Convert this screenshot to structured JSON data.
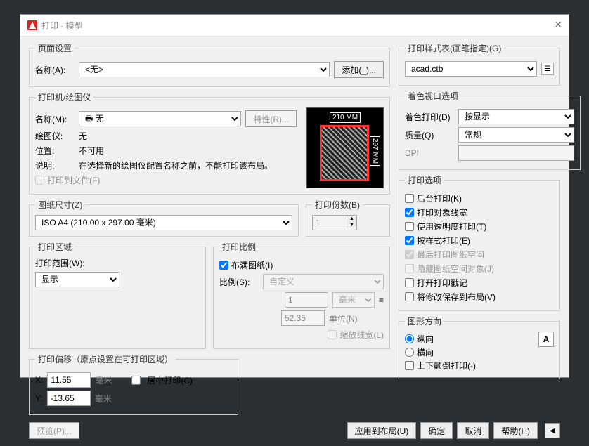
{
  "window": {
    "title": "打印 - 模型"
  },
  "page_setup": {
    "legend": "页面设置",
    "name_label": "名称(A):",
    "name_value": "<无>",
    "add_btn": "添加(_)..."
  },
  "printer": {
    "legend": "打印机/绘图仪",
    "name_label": "名称(M):",
    "name_value": "🖶 无",
    "props_btn": "特性(R)...",
    "plotter_label": "绘图仪:",
    "plotter_value": "无",
    "where_label": "位置:",
    "where_value": "不可用",
    "desc_label": "说明:",
    "desc_value": "在选择新的绘图仪配置名称之前，不能打印该布局。",
    "to_file": "打印到文件(F)",
    "preview_w": "210 MM",
    "preview_h": "297 MM"
  },
  "paper": {
    "legend": "图纸尺寸(Z)",
    "value": "ISO A4 (210.00 x 297.00 毫米)"
  },
  "copies": {
    "legend": "打印份数(B)",
    "value": "1"
  },
  "area": {
    "legend": "打印区域",
    "what_label": "打印范围(W):",
    "what_value": "显示"
  },
  "scale": {
    "legend": "打印比例",
    "fit": "布满图纸(I)",
    "ratio_label": "比例(S):",
    "ratio_value": "自定义",
    "unit_val": "1",
    "unit_sel": "毫米",
    "drawing_units": "52.35",
    "drawing_units_label": "单位(N)",
    "scale_lw": "缩放线宽(L)"
  },
  "offset": {
    "legend": "打印偏移（原点设置在可打印区域）",
    "x_label": "X:",
    "x_value": "11.55",
    "y_label": "Y:",
    "y_value": "-13.65",
    "unit": "毫米",
    "center": "居中打印(C)"
  },
  "style_table": {
    "legend": "打印样式表(画笔指定)(G)",
    "value": "acad.ctb"
  },
  "viewport": {
    "legend": "着色视口选项",
    "shade_label": "着色打印(D)",
    "shade_value": "按显示",
    "quality_label": "质量(Q)",
    "quality_value": "常规",
    "dpi_label": "DPI"
  },
  "options": {
    "legend": "打印选项",
    "bg": "后台打印(K)",
    "lw": "打印对象线宽",
    "trans": "使用透明度打印(T)",
    "styles": "按样式打印(E)",
    "last": "最后打印图纸空间",
    "hide": "隐藏图纸空间对象(J)",
    "stamp": "打开打印戳记",
    "save": "将修改保存到布局(V)"
  },
  "orientation": {
    "legend": "图形方向",
    "portrait": "纵向",
    "landscape": "横向",
    "upside": "上下颠倒打印(-)",
    "icon": "A"
  },
  "footer": {
    "preview": "预览(P)...",
    "apply": "应用到布局(U)",
    "ok": "确定",
    "cancel": "取消",
    "help": "帮助(H)"
  }
}
